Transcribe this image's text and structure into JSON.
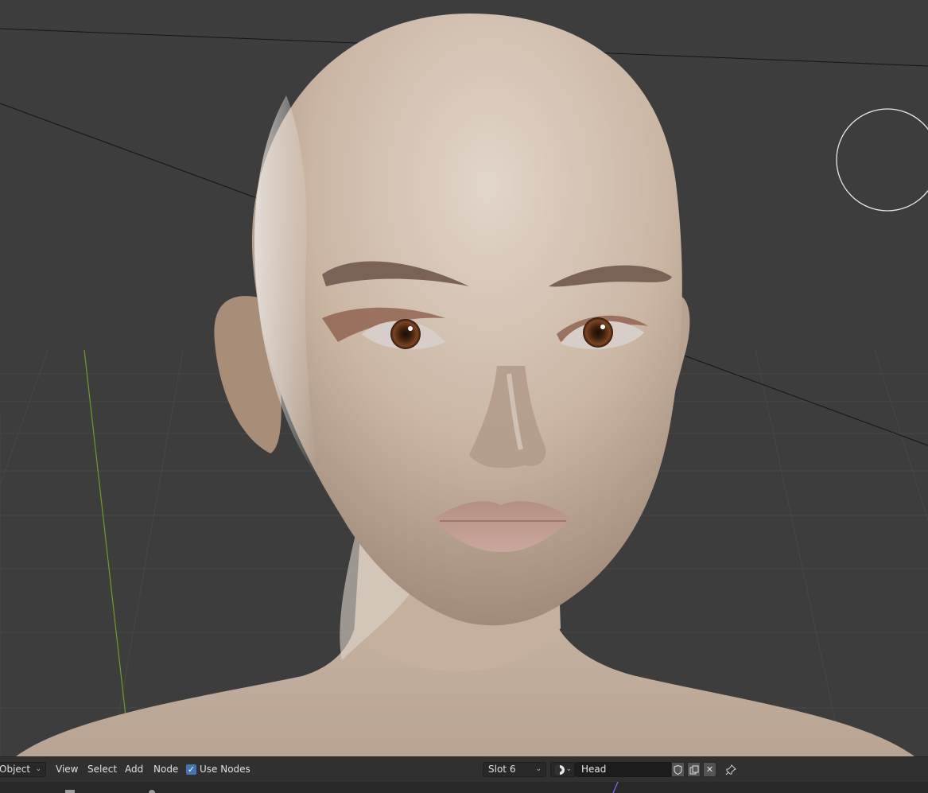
{
  "header": {
    "mode_label": "Object",
    "menu": {
      "view": "View",
      "select": "Select",
      "add": "Add",
      "node": "Node"
    },
    "use_nodes_label": "Use Nodes",
    "use_nodes_checked": true,
    "slot_label": "Slot 6",
    "material_name": "Head",
    "icons": {
      "chevron": "chevron-down-icon",
      "material_ball": "material-sphere-icon",
      "fake_user": "shield-icon",
      "duplicate": "duplicate-icon",
      "unlink": "close-icon",
      "pin": "pin-icon"
    }
  },
  "colors": {
    "viewport_bg": "#3d3d3d",
    "header_bg": "#303030",
    "accent_blue": "#4772b3",
    "y_axis_green": "#6f9a2b",
    "skin": "#cbb7a7"
  }
}
